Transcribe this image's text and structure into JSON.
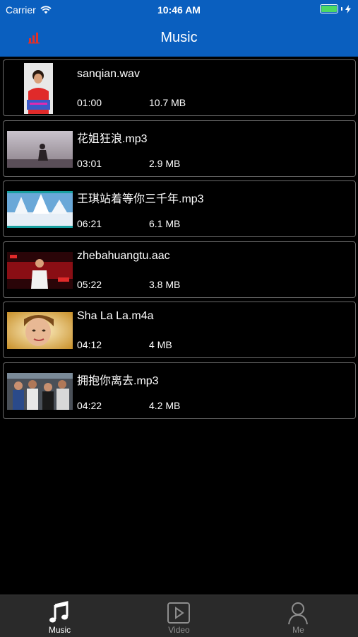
{
  "status_bar": {
    "carrier": "Carrier",
    "time": "10:46 AM"
  },
  "nav": {
    "title": "Music",
    "left_icon": "signal-bars-icon"
  },
  "items": [
    {
      "name": "sanqian.wav",
      "duration": "01:00",
      "size": "10.7 MB",
      "thumb": "portrait"
    },
    {
      "name": "花姐狂浪.mp3",
      "duration": "03:01",
      "size": "2.9 MB",
      "thumb": "dusk"
    },
    {
      "name": "王琪站着等你三千年.mp3",
      "duration": "06:21",
      "size": "6.1 MB",
      "thumb": "snow"
    },
    {
      "name": "zhebahuangtu.aac",
      "duration": "05:22",
      "size": "3.8 MB",
      "thumb": "stage"
    },
    {
      "name": "Sha La La.m4a",
      "duration": "04:12",
      "size": "4 MB",
      "thumb": "face"
    },
    {
      "name": "拥抱你离去.mp3",
      "duration": "04:22",
      "size": "4.2 MB",
      "thumb": "crowd"
    }
  ],
  "tabs": [
    {
      "label": "Music",
      "icon": "music-note-icon",
      "active": true
    },
    {
      "label": "Video",
      "icon": "play-icon",
      "active": false
    },
    {
      "label": "Me",
      "icon": "person-icon",
      "active": false
    }
  ],
  "colors": {
    "nav_blue": "#0a5fbf",
    "active_tab": "#ffffff",
    "inactive_tab": "#8e8e8e",
    "signal_red": "#e0302a"
  }
}
